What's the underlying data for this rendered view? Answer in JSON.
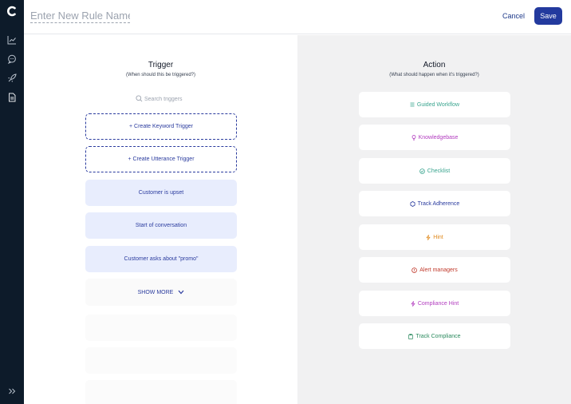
{
  "header": {
    "rule_name_placeholder": "Enter New Rule Name",
    "cancel_label": "Cancel",
    "save_label": "Save"
  },
  "sidebar": {
    "logo": "C",
    "icons": [
      "analytics-icon",
      "chat-icon",
      "rocket-icon",
      "document-icon",
      "expand-icon"
    ]
  },
  "trigger": {
    "title": "Trigger",
    "subtitle": "(When should this be triggered?)",
    "search_placeholder": "Search triggers",
    "create_keyword": "+ Create Keyword Trigger",
    "create_utterance": "+ Create Utterance Trigger",
    "items": [
      "Customer is upset",
      "Start of conversation",
      "Customer asks about \"promo\""
    ],
    "show_more": "SHOW MORE"
  },
  "action": {
    "title": "Action",
    "subtitle": "(What should happen when it's triggered?)",
    "items": [
      {
        "label": "Guided Workflow",
        "icon": "list-icon",
        "color": "#3aa58f"
      },
      {
        "label": "Knowledgebase",
        "icon": "bulb-icon",
        "color": "#b23cbf"
      },
      {
        "label": "Checklist",
        "icon": "check-circle-icon",
        "color": "#3aa58f"
      },
      {
        "label": "Track Adherence",
        "icon": "hexagon-icon",
        "color": "#2a3b9e"
      },
      {
        "label": "Hint",
        "icon": "bolt-icon",
        "color": "#e08a1e"
      },
      {
        "label": "Alert managers",
        "icon": "alert-circle-icon",
        "color": "#c0392b"
      },
      {
        "label": "Compliance Hint",
        "icon": "bolt-icon",
        "color": "#b23cbf"
      },
      {
        "label": "Track Compliance",
        "icon": "clipboard-icon",
        "color": "#2b8a5e"
      }
    ]
  },
  "colors": {
    "sidebar_bg": "#0d1b2a",
    "primary": "#233a9e",
    "trigger_fill": "#e8edfd",
    "action_panel_bg": "#f1f1f2"
  }
}
